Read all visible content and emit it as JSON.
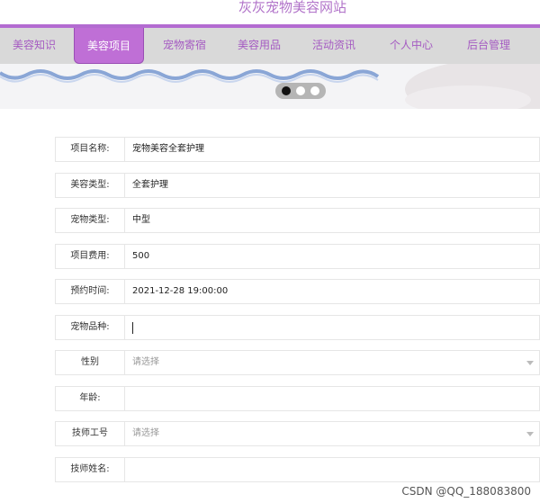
{
  "header": {
    "title": "灰灰宠物美容网站"
  },
  "nav": {
    "items": [
      {
        "label": "美容知识"
      },
      {
        "label": "美容项目"
      },
      {
        "label": "宠物寄宿"
      },
      {
        "label": "美容用品"
      },
      {
        "label": "活动资讯"
      },
      {
        "label": "个人中心"
      },
      {
        "label": "后台管理"
      }
    ],
    "active_index": 1
  },
  "carousel": {
    "slide_count": 3,
    "active_index": 0
  },
  "form": {
    "project_name": {
      "label": "项目名称:",
      "value": "宠物美容全套护理"
    },
    "beauty_type": {
      "label": "美容类型:",
      "value": "全套护理"
    },
    "pet_type": {
      "label": "宠物类型:",
      "value": "中型"
    },
    "cost": {
      "label": "项目费用:",
      "value": "500"
    },
    "appointment_time": {
      "label": "预约时间:",
      "value": "2021-12-28 19:00:00"
    },
    "pet_breed": {
      "label": "宠物品种:",
      "value": ""
    },
    "gender": {
      "label": "性别",
      "placeholder": "请选择"
    },
    "age": {
      "label": "年龄:",
      "value": ""
    },
    "tech_id": {
      "label": "技师工号",
      "placeholder": "请选择"
    },
    "tech_name": {
      "label": "技师姓名:",
      "value": ""
    }
  },
  "watermark": "CSDN @QQ_188083800"
}
